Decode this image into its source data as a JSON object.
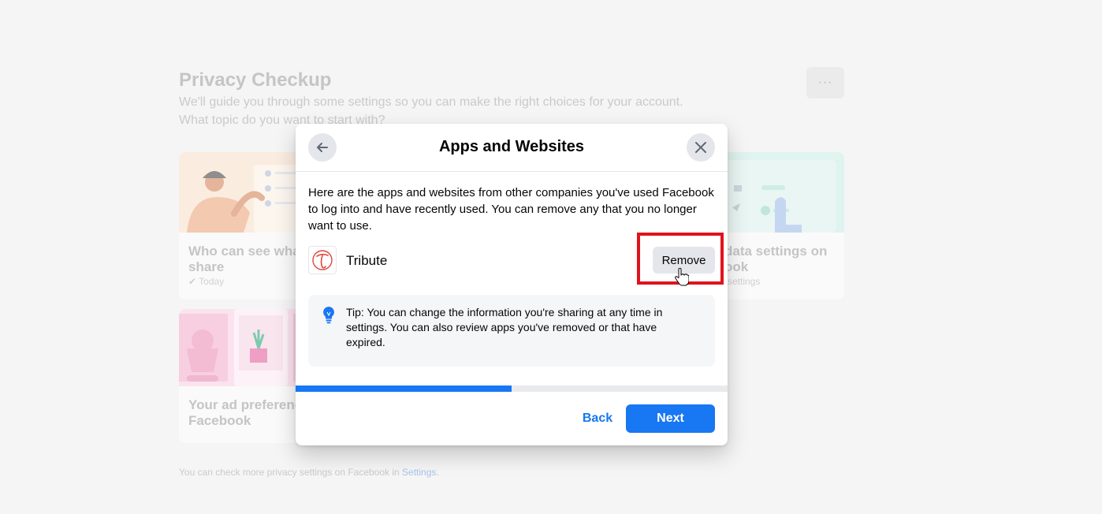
{
  "background": {
    "title": "Privacy Checkup",
    "subtitle_line1": "We'll guide you through some settings so you can make the right choices for your account.",
    "subtitle_line2": "What topic do you want to start with?",
    "more_label": "···",
    "cards": {
      "who_can_see": {
        "title_line1": "Who can see what",
        "title_line2": "share",
        "meta": "Today"
      },
      "data_settings": {
        "title_line1": "data settings on",
        "title_line2": "ook",
        "meta": "settings"
      },
      "ad_prefs": {
        "title_line1": "Your ad preferenc",
        "title_line2": "Facebook"
      }
    },
    "footer_text": "You can check more privacy settings on Facebook in ",
    "footer_link": "Settings",
    "footer_end": "."
  },
  "modal": {
    "title": "Apps and Websites",
    "back_icon": "arrow-left-icon",
    "close_icon": "close-icon",
    "description": "Here are the apps and websites from other companies you've used Facebook to log into and have recently used. You can remove any that you no longer want to use.",
    "app": {
      "name": "Tribute",
      "logo_glyph": "T",
      "remove_label": "Remove"
    },
    "tip": {
      "icon": "lightbulb-icon",
      "text": "Tip: You can change the information you're sharing at any time in settings. You can also review apps you've removed or that have expired."
    },
    "progress_fraction": 0.5,
    "back_label": "Back",
    "next_label": "Next"
  },
  "colors": {
    "primary": "#1877f2",
    "highlight": "#e0131c",
    "logo_red": "#e0483d"
  }
}
